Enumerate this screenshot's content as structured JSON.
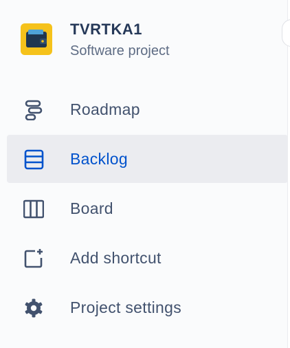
{
  "project": {
    "name": "TVRTKA1",
    "type": "Software project",
    "avatar_icon": "wallet-icon",
    "avatar_color": "#f5c21b"
  },
  "nav": {
    "items": [
      {
        "label": "Roadmap",
        "icon": "roadmap-icon",
        "active": false
      },
      {
        "label": "Backlog",
        "icon": "backlog-icon",
        "active": true
      },
      {
        "label": "Board",
        "icon": "board-icon",
        "active": false
      },
      {
        "label": "Add shortcut",
        "icon": "add-shortcut-icon",
        "active": false
      },
      {
        "label": "Project settings",
        "icon": "gear-icon",
        "active": false
      }
    ]
  },
  "colors": {
    "text": "#42526e",
    "active_text": "#0052cc",
    "active_bg": "#ebecf0",
    "title": "#253858",
    "subtitle": "#5e6c84"
  }
}
